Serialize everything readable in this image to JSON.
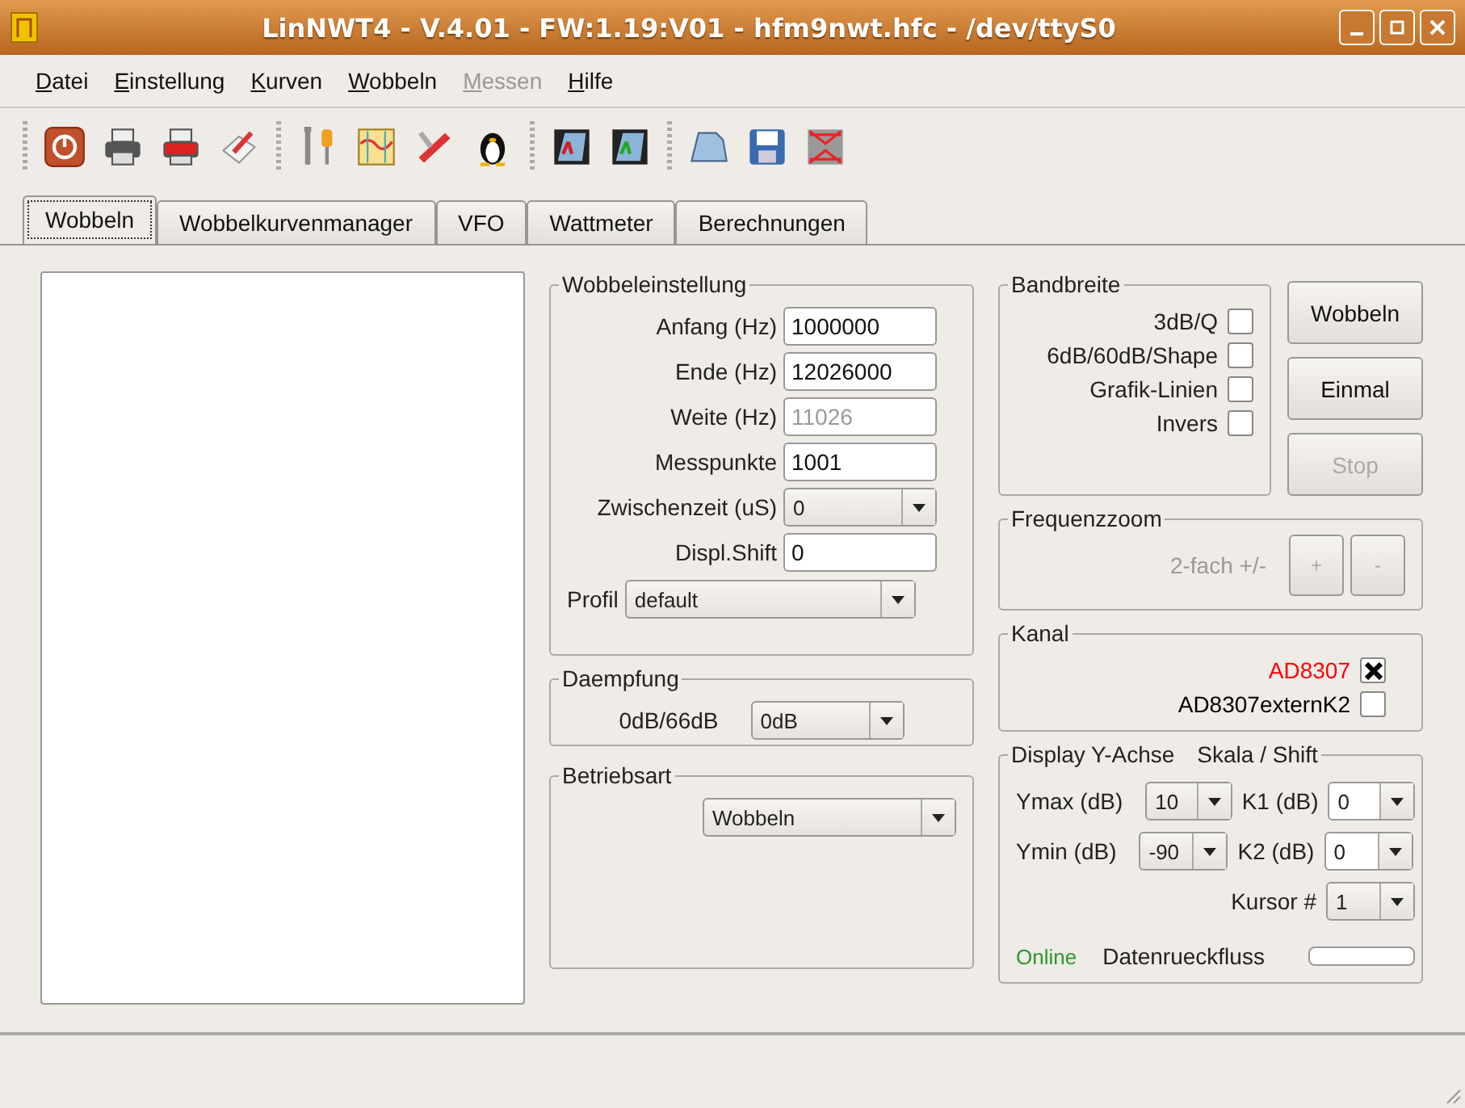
{
  "window": {
    "title": "LinNWT4 - V.4.01 - FW:1.19:V01 - hfm9nwt.hfc - /dev/ttyS0"
  },
  "menu": [
    {
      "label": "Datei",
      "disabled": false
    },
    {
      "label": "Einstellung",
      "disabled": false
    },
    {
      "label": "Kurven",
      "disabled": false
    },
    {
      "label": "Wobbeln",
      "disabled": false
    },
    {
      "label": "Messen",
      "disabled": true
    },
    {
      "label": "Hilfe",
      "disabled": false
    }
  ],
  "tabs": [
    {
      "label": "Wobbeln",
      "selected": true
    },
    {
      "label": "Wobbelkurvenmanager",
      "selected": false
    },
    {
      "label": "VFO",
      "selected": false
    },
    {
      "label": "Wattmeter",
      "selected": false
    },
    {
      "label": "Berechnungen",
      "selected": false
    }
  ],
  "wobbeleinstellung": {
    "title": "Wobbeleinstellung",
    "rows": [
      {
        "label": "Anfang (Hz)",
        "kind": "input",
        "value": "1000000",
        "disabled": false
      },
      {
        "label": "Ende (Hz)",
        "kind": "input",
        "value": "12026000",
        "disabled": false
      },
      {
        "label": "Weite (Hz)",
        "kind": "input",
        "value": "11026",
        "disabled": true
      },
      {
        "label": "Messpunkte",
        "kind": "input",
        "value": "1001",
        "disabled": false
      },
      {
        "label": "Zwischenzeit (uS)",
        "kind": "select",
        "value": "0",
        "disabled": false
      },
      {
        "label": "Displ.Shift",
        "kind": "input",
        "value": "0",
        "disabled": false
      }
    ],
    "profil": {
      "label": "Profil",
      "value": "default"
    }
  },
  "daempfung": {
    "title": "Daempfung",
    "label": "0dB/66dB",
    "value": "0dB"
  },
  "betriebsart": {
    "title": "Betriebsart",
    "value": "Wobbeln"
  },
  "bandbreite": {
    "title": "Bandbreite",
    "options": [
      {
        "label": "3dB/Q",
        "checked": false
      },
      {
        "label": "6dB/60dB/Shape",
        "checked": false
      },
      {
        "label": "Grafik-Linien",
        "checked": false
      },
      {
        "label": "Invers",
        "checked": false
      }
    ]
  },
  "buttons": [
    {
      "label": "Wobbeln",
      "disabled": false
    },
    {
      "label": "Einmal",
      "disabled": false
    },
    {
      "label": "Stop",
      "disabled": true
    }
  ],
  "frequenzzoom": {
    "title": "Frequenzzoom",
    "label": "2-fach +/-",
    "disabled": true,
    "buttons": [
      "+",
      "-"
    ]
  },
  "kanal": {
    "title": "Kanal",
    "options": [
      {
        "label": "AD8307",
        "checked": true,
        "color": "#ff0000"
      },
      {
        "label": "AD8307externK2",
        "checked": false,
        "color": "#000000"
      }
    ]
  },
  "display": {
    "title": "Display Y-Achse",
    "subtitle": "Skala / Shift",
    "rows": [
      {
        "label": "Ymax (dB)",
        "value": "10",
        "k_label": "K1 (dB)",
        "k_value": "0"
      },
      {
        "label": "Ymin (dB)",
        "value": "-90",
        "k_label": "K2 (dB)",
        "k_value": "0"
      }
    ],
    "kursor": {
      "label": "Kursor #",
      "value": "1"
    },
    "status": "Online",
    "flow_label": "Datenrueckfluss",
    "level": 0
  }
}
